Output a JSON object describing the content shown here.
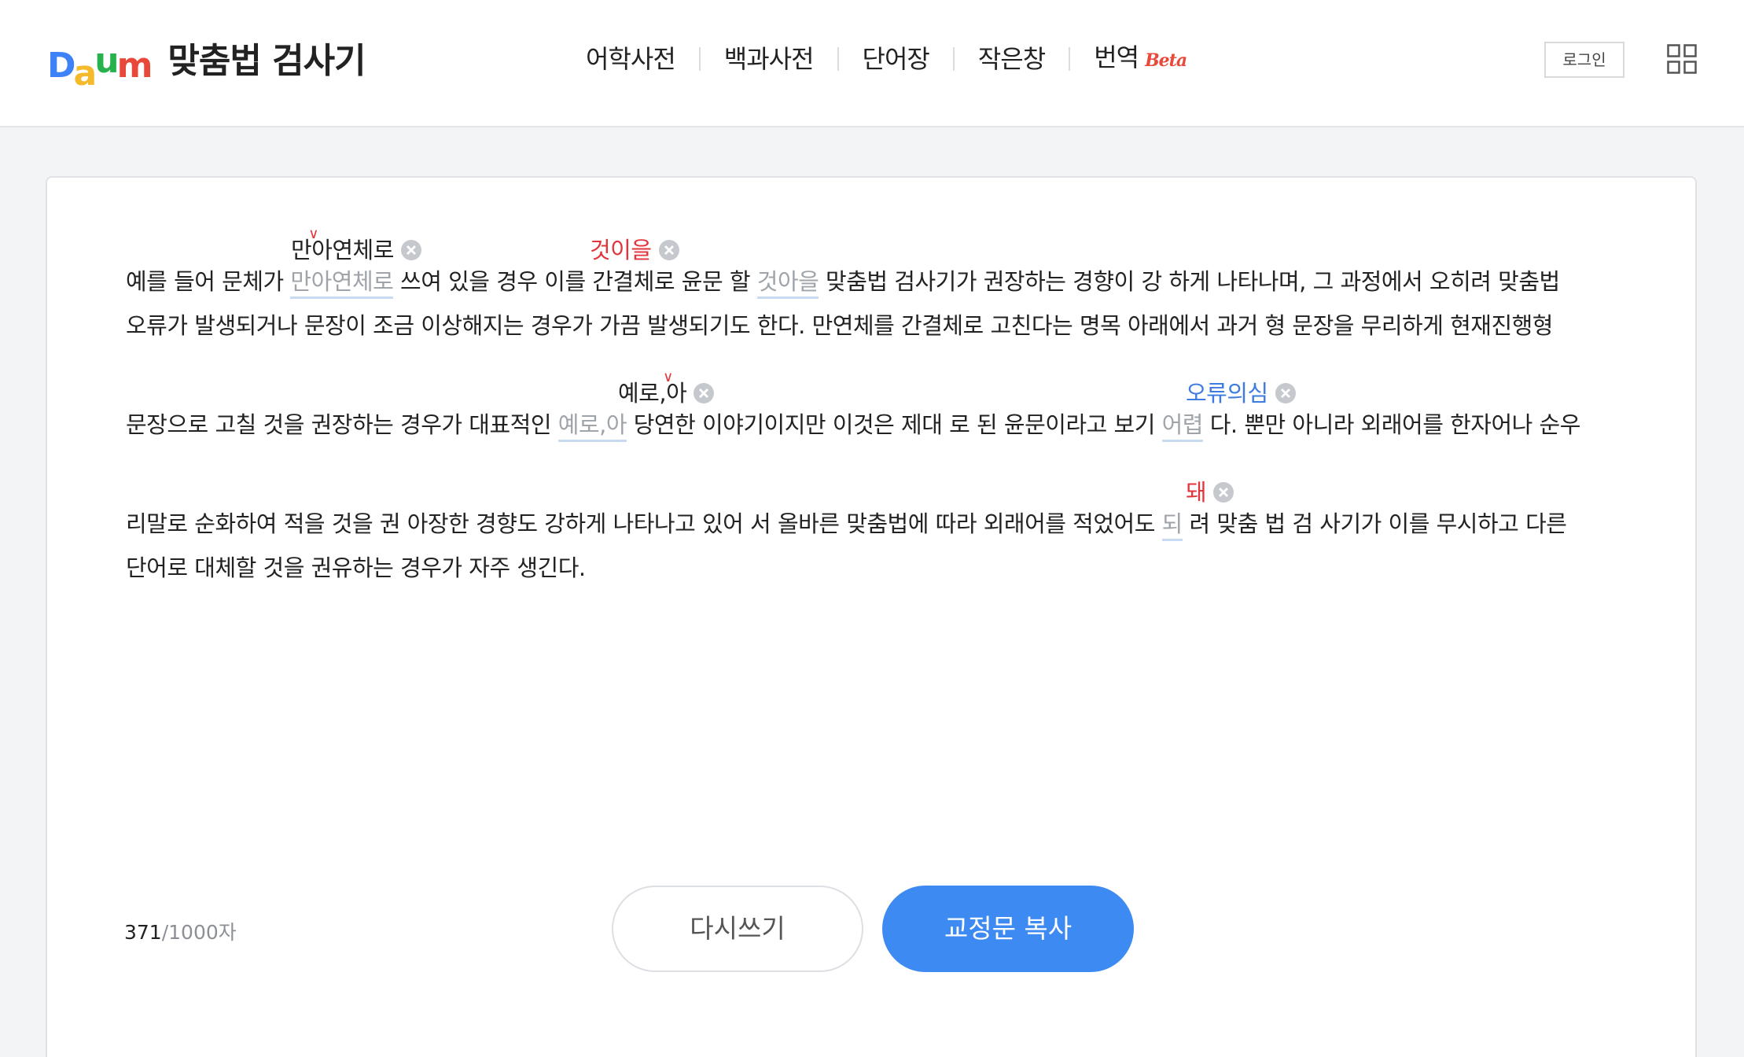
{
  "header": {
    "logo_text": "Daum",
    "app_title": "맞춤법 검사기",
    "nav": [
      {
        "label": "어학사전"
      },
      {
        "label": "백과사전"
      },
      {
        "label": "단어장"
      },
      {
        "label": "작은창"
      },
      {
        "label": "번역",
        "badge": "Beta"
      }
    ],
    "login_label": "로그인",
    "grid_icon": "app-grid-icon"
  },
  "editor": {
    "lines": {
      "l1_a": "예를 들어 문체가",
      "l1_err1": "만아연체로",
      "l1_b": "쓰여 있을 경우 이를 간결체로 윤문 할",
      "l1_err2": "것아을",
      "l1_c": "맞춤법 검사기가 권장하는 경향이 강 하게 나타나며, 그 과정에서 오히려 맞춤법",
      "l2": "오류가 발생되거나 문장이 조금 이상해지는 경우가 가끔 발생되기도 한다. 만연체를 간결체로 고친다는 명목 아래에서 과거 형 문장을 무리하게 현재진행형",
      "l3_a": "문장으로 고칠 것을 권장하는 경우가 대표적인",
      "l3_err1": "예로,아",
      "l3_b": "당연한 이야기이지만 이것은 제대 로 된 윤문이라고 보기",
      "l3_err2": "어렵",
      "l3_c": "다. 뿐만 아니라 외래어를 한자어나 순우",
      "l4_a": "리말로 순화하여 적을 것을 권 아장한 경향도 강하게 나타나고 있어 서 올바른 맞춤법에 따라 외래어를 적었어도",
      "l4_err1": "되",
      "l4_b": "려 맞춤 법 검 사기가 이를 무시하고 다른",
      "l5": "단어로 대체할 것을 권유하는 경우가 자주 생긴다."
    },
    "suggestions": {
      "s1_left": "만",
      "s1_right": "아연체로",
      "s2": "것이을",
      "s3_left": "예로,",
      "s3_right": "아",
      "s4": "오류의심",
      "s5": "돼"
    },
    "colors": {
      "spacing_suggestion": "#222222",
      "spelling_suggestion": "#e3343c",
      "suspected_error": "#3d7be0",
      "error_word": "#9fa4ab",
      "error_underline": "#c8d9f2"
    }
  },
  "footer": {
    "char_count": "371",
    "char_total": "/1000자",
    "rewrite_label": "다시쓰기",
    "copy_label": "교정문 복사"
  },
  "colors": {
    "accent": "#3d8af3",
    "page_bg": "#f3f4f5"
  }
}
